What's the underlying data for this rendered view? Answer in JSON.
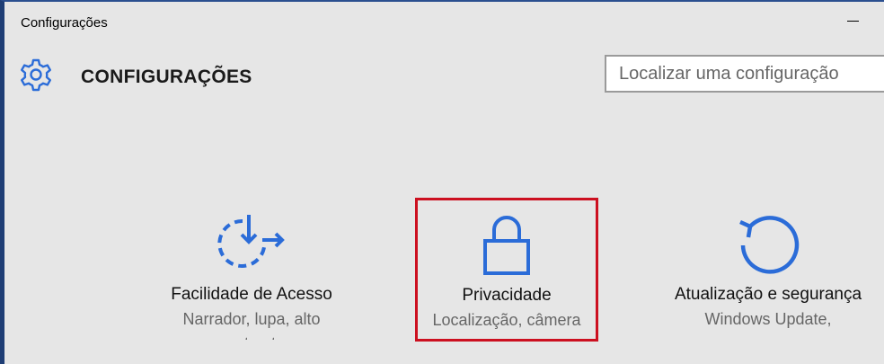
{
  "window": {
    "title": "Configurações"
  },
  "header": {
    "app_title": "CONFIGURAÇÕES",
    "search_placeholder": "Localizar uma configuração"
  },
  "tiles": [
    {
      "icon": "ease-of-access-icon",
      "name": "Facilidade de Acesso",
      "desc": "Narrador, lupa, alto",
      "desc2": "contraste"
    },
    {
      "icon": "lock-icon",
      "name": "Privacidade",
      "desc": "Localização, câmera",
      "highlighted": true
    },
    {
      "icon": "refresh-icon",
      "name": "Atualização e segurança",
      "desc": "Windows Update,"
    }
  ],
  "colors": {
    "accent": "#2b6cd8",
    "highlight_border": "#cc1020",
    "background": "#e6e6e6"
  }
}
